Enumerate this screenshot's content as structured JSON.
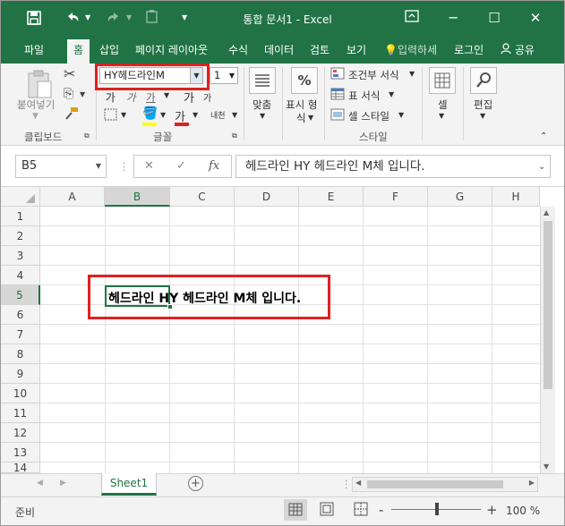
{
  "app": {
    "title": "통합 문서1 - Excel",
    "accent": "#217346"
  },
  "qat": {
    "save_icon": "save-icon",
    "undo_icon": "undo-icon",
    "redo_icon": "redo-icon"
  },
  "window": {
    "ribbon_options_icon": "ribbon-display-icon",
    "minimize": "─",
    "maximize": "☐",
    "close": "✕"
  },
  "tabs": [
    {
      "label": "파일"
    },
    {
      "label": "홈"
    },
    {
      "label": "삽입"
    },
    {
      "label": "페이지 레이아웃"
    },
    {
      "label": "수식"
    },
    {
      "label": "데이터"
    },
    {
      "label": "검토"
    },
    {
      "label": "보기"
    }
  ],
  "tellme": "입력하세",
  "signin": "로그인",
  "share": "공유",
  "ribbon": {
    "clipboard": {
      "paste": "붙여넣기",
      "group": "클립보드"
    },
    "font": {
      "name": "HY헤드라인M",
      "size": "1",
      "group": "글꼴",
      "bold": "가",
      "italic": "가",
      "underline": "가",
      "font_color": "가",
      "phonetic": "내천",
      "grow": "가",
      "shrink": "가"
    },
    "alignment": {
      "label": "맞춤"
    },
    "number": {
      "label_line1": "표시 형",
      "label_line2": "식",
      "percent": "%"
    },
    "styles": {
      "conditional": "조건부 서식",
      "table": "표 서식",
      "cell": "셀 스타일",
      "group": "스타일"
    },
    "cells": {
      "label": "셀"
    },
    "editing": {
      "label": "편집"
    }
  },
  "formula_bar": {
    "name_box": "B5",
    "cancel": "✕",
    "enter": "✓",
    "fx": "fx",
    "value": "헤드라인 HY 헤드라인 M체 입니다."
  },
  "grid": {
    "columns": [
      "A",
      "B",
      "C",
      "D",
      "E",
      "F",
      "G",
      "H"
    ],
    "rows": [
      "1",
      "2",
      "3",
      "4",
      "5",
      "6",
      "7",
      "8",
      "9",
      "10",
      "11",
      "12",
      "13",
      "14"
    ],
    "selected_cell": "B5",
    "cell_text": "헤드라인 HY 헤드라인 M체 입니다."
  },
  "sheets": {
    "tabs": [
      "Sheet1"
    ],
    "add": "+"
  },
  "status": {
    "mode": "준비",
    "zoom": "100 %",
    "zoom_minus": "-",
    "zoom_plus": "+"
  }
}
